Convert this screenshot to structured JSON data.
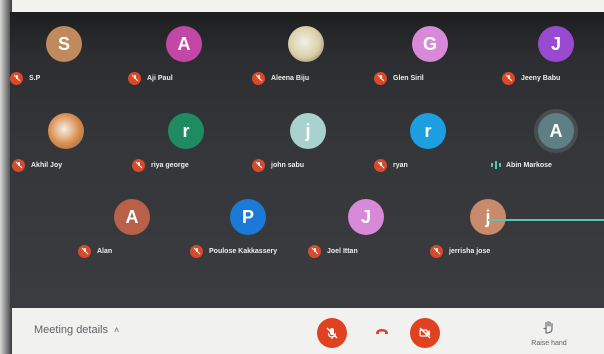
{
  "colors": {
    "mute_badge": "#d94a2b",
    "control_button": "#e0411f",
    "active_speaker": "#5cc4b4",
    "control_bar": "#f1f1ef"
  },
  "participants": [
    {
      "initial": "S",
      "name": "S.P",
      "color": "#c08a5c"
    },
    {
      "initial": "A",
      "name": "Aji Paul",
      "color": "#c247a6"
    },
    {
      "initial": "",
      "name": "Aleena Biju",
      "color": "#d9cfa8",
      "photo": true
    },
    {
      "initial": "G",
      "name": "Glen Siril",
      "color": "#d88ad8"
    },
    {
      "initial": "J",
      "name": "Jeeny Babu",
      "color": "#9a4ad0"
    },
    {
      "initial": "",
      "name": "Akhil Joy",
      "color": "#d98a4a",
      "photo": true
    },
    {
      "initial": "r",
      "name": "riya george",
      "color": "#1e8b63"
    },
    {
      "initial": "j",
      "name": "john sabu",
      "color": "#a9d2cf"
    },
    {
      "initial": "r",
      "name": "ryan",
      "color": "#1c9fe0"
    },
    {
      "initial": "A",
      "name": "Abin Markose",
      "color": "#5e7f83",
      "speaking": true
    },
    {
      "initial": "A",
      "name": "Alan",
      "color": "#b86048"
    },
    {
      "initial": "P",
      "name": "Poulose Kakkassery",
      "color": "#1a7ad6"
    },
    {
      "initial": "J",
      "name": "Joel Ittan",
      "color": "#d88ad8"
    },
    {
      "initial": "j",
      "name": "jerrisha jose",
      "color": "#c88a6a"
    }
  ],
  "controls": {
    "meeting_details": "Meeting details",
    "raise_hand": "Raise hand"
  }
}
